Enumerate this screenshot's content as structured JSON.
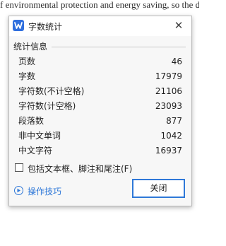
{
  "document": {
    "line1": "f environmental protection and energy saving, so the dema",
    "line2_end": "rm"
  },
  "dialog": {
    "title": "字数统计",
    "close_glyph": "✕",
    "group_title": "统计信息",
    "stats": [
      {
        "label": "页数",
        "value": "46"
      },
      {
        "label": "字数",
        "value": "17979"
      },
      {
        "label": "字符数(不计空格)",
        "value": "21106"
      },
      {
        "label": "字符数(计空格)",
        "value": "23093"
      },
      {
        "label": "段落数",
        "value": "877"
      },
      {
        "label": "非中文单词",
        "value": "1042"
      },
      {
        "label": "中文字符",
        "value": "16937"
      }
    ],
    "checkbox_label": "包括文本框、脚注和尾注(F)",
    "checkbox_checked": false,
    "tips_label": "操作技巧",
    "close_button": "关闭"
  },
  "colors": {
    "accent": "#2f78d8",
    "app_icon": "#2f6fde"
  }
}
